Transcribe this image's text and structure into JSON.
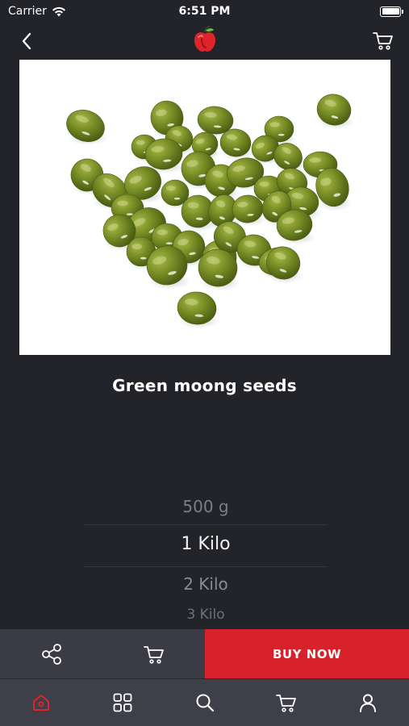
{
  "status": {
    "carrier": "Carrier",
    "time": "6:51 PM"
  },
  "nav": {
    "back_icon": "chevron-left-icon",
    "logo_icon": "apple-logo-icon",
    "cart_icon": "cart-icon"
  },
  "product": {
    "title": "Green moong seeds",
    "image": "green moong beans photo"
  },
  "picker": {
    "options": [
      "500 g",
      "1 Kilo",
      "2 Kilo",
      "3 Kilo"
    ],
    "selected": "1 Kilo"
  },
  "actions": {
    "share_icon": "share-icon",
    "add_to_cart_icon": "cart-icon",
    "buy_label": "BUY NOW"
  },
  "tabs": [
    {
      "name": "home",
      "icon": "home-icon",
      "active": true
    },
    {
      "name": "categories",
      "icon": "grid-icon",
      "active": false
    },
    {
      "name": "search",
      "icon": "search-icon",
      "active": false
    },
    {
      "name": "cart",
      "icon": "cart-icon",
      "active": false
    },
    {
      "name": "account",
      "icon": "user-icon",
      "active": false
    }
  ],
  "colors": {
    "background": "#232429",
    "accent": "#d8222b",
    "action_bar": "#3a3b45",
    "tab_bar": "#3e3f48"
  }
}
